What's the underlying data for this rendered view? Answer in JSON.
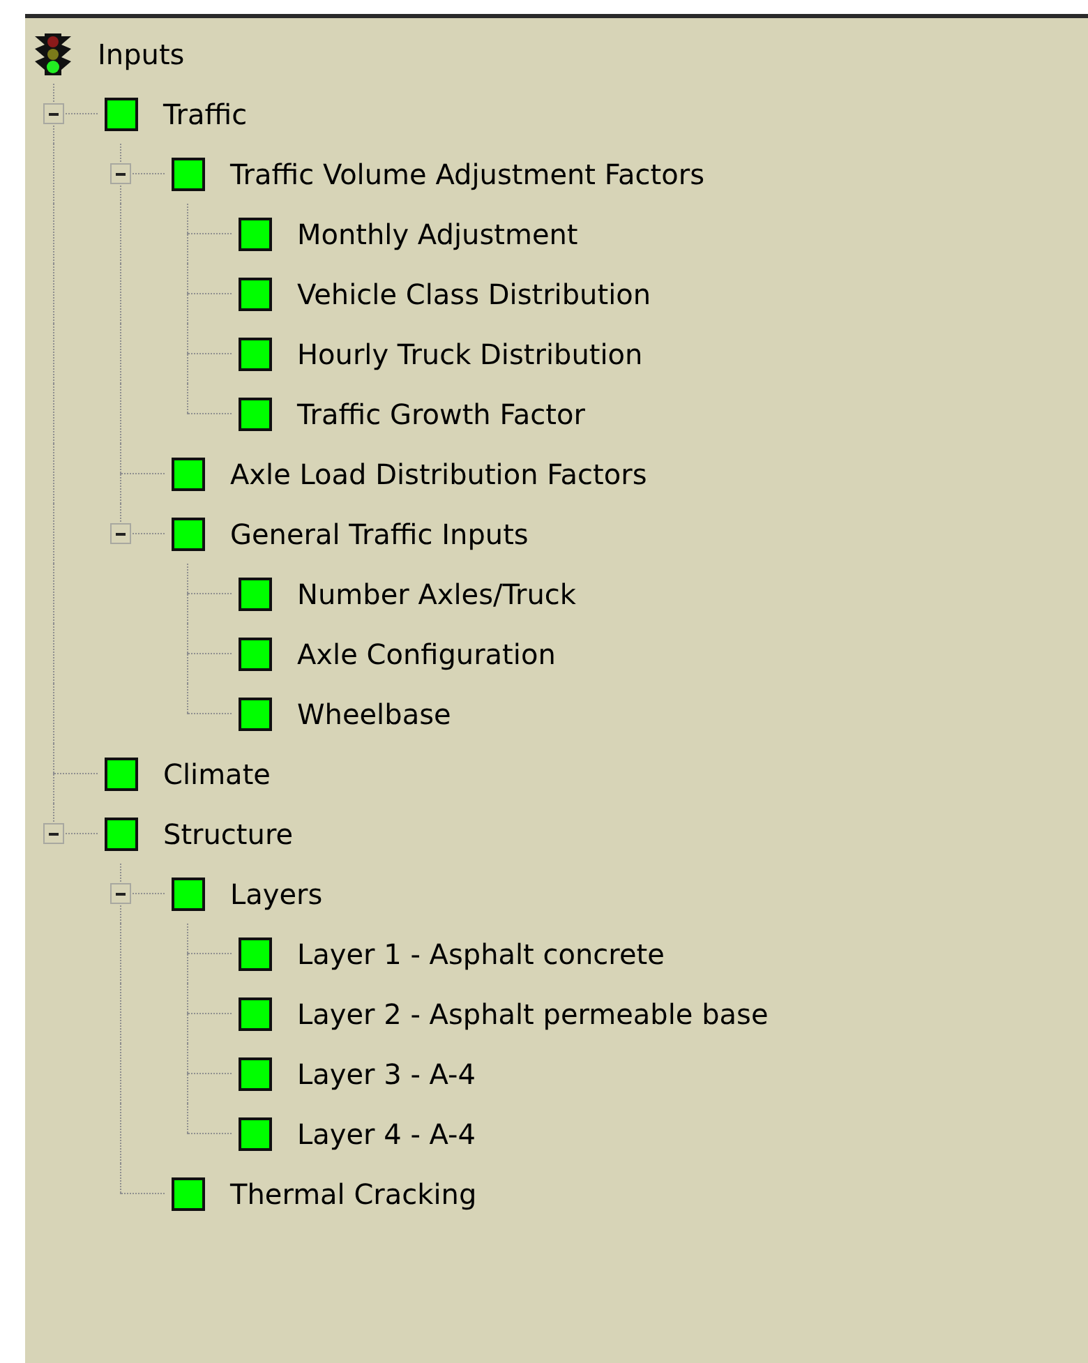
{
  "tree": {
    "label": "Inputs",
    "children": [
      {
        "label": "Traffic",
        "color": "#00ff00",
        "expanded": true,
        "children": [
          {
            "label": "Traffic Volume Adjustment Factors",
            "color": "#00ff00",
            "expanded": true,
            "children": [
              {
                "label": "Monthly Adjustment",
                "color": "#00ff00"
              },
              {
                "label": "Vehicle Class Distribution",
                "color": "#00ff00"
              },
              {
                "label": "Hourly Truck Distribution",
                "color": "#00ff00"
              },
              {
                "label": "Traffic Growth Factor",
                "color": "#00ff00"
              }
            ]
          },
          {
            "label": "Axle Load Distribution Factors",
            "color": "#00ff00"
          },
          {
            "label": "General Traffic Inputs",
            "color": "#00ff00",
            "expanded": true,
            "children": [
              {
                "label": "Number Axles/Truck",
                "color": "#00ff00"
              },
              {
                "label": "Axle Configuration",
                "color": "#00ff00"
              },
              {
                "label": "Wheelbase",
                "color": "#00ff00"
              }
            ]
          }
        ]
      },
      {
        "label": "Climate",
        "color": "#00ff00"
      },
      {
        "label": "Structure",
        "color": "#00ff00",
        "expanded": true,
        "children": [
          {
            "label": "Layers",
            "color": "#00ff00",
            "expanded": true,
            "children": [
              {
                "label": "Layer 1 - Asphalt concrete",
                "color": "#00ff00"
              },
              {
                "label": "Layer 2 - Asphalt permeable base",
                "color": "#00ff00"
              },
              {
                "label": "Layer 3 - A-4",
                "color": "#00ff00"
              },
              {
                "label": "Layer 4 - A-4",
                "color": "#00ff00"
              }
            ]
          },
          {
            "label": "Thermal Cracking",
            "color": "#00ff00"
          }
        ]
      }
    ]
  }
}
